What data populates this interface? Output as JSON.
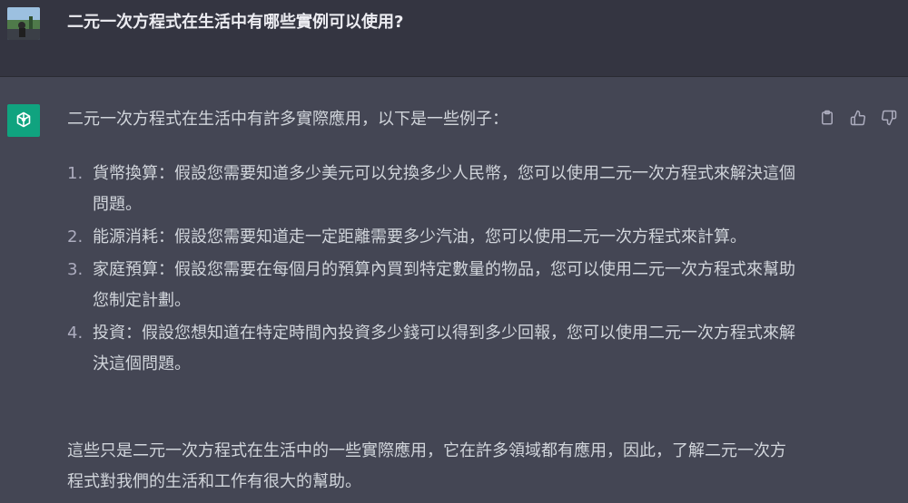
{
  "user_message": {
    "text": "二元一次方程式在生活中有哪些實例可以使用?"
  },
  "assistant_message": {
    "intro": "二元一次方程式在生活中有許多實際應用，以下是一些例子：",
    "items": [
      {
        "num": "1.",
        "text": "貨幣換算：假設您需要知道多少美元可以兌換多少人民幣，您可以使用二元一次方程式來解決這個問題。"
      },
      {
        "num": "2.",
        "text": "能源消耗：假設您需要知道走一定距離需要多少汽油，您可以使用二元一次方程式來計算。"
      },
      {
        "num": "3.",
        "text": "家庭預算：假設您需要在每個月的預算內買到特定數量的物品，您可以使用二元一次方程式來幫助您制定計劃。"
      },
      {
        "num": "4.",
        "text": "投資：假設您想知道在特定時間內投資多少錢可以得到多少回報，您可以使用二元一次方程式來解決這個問題。"
      }
    ],
    "outro": "這些只是二元一次方程式在生活中的一些實際應用，它在許多領域都有應用，因此，了解二元一次方程式對我們的生活和工作有很大的幫助。"
  },
  "icons": {
    "copy": "clipboard-icon",
    "like": "thumbs-up-icon",
    "dislike": "thumbs-down-icon",
    "bot": "openai-logo-icon"
  },
  "colors": {
    "user_bg": "#343541",
    "assistant_bg": "#444654",
    "bot_avatar": "#10a37f",
    "text": "#d1d5db"
  }
}
